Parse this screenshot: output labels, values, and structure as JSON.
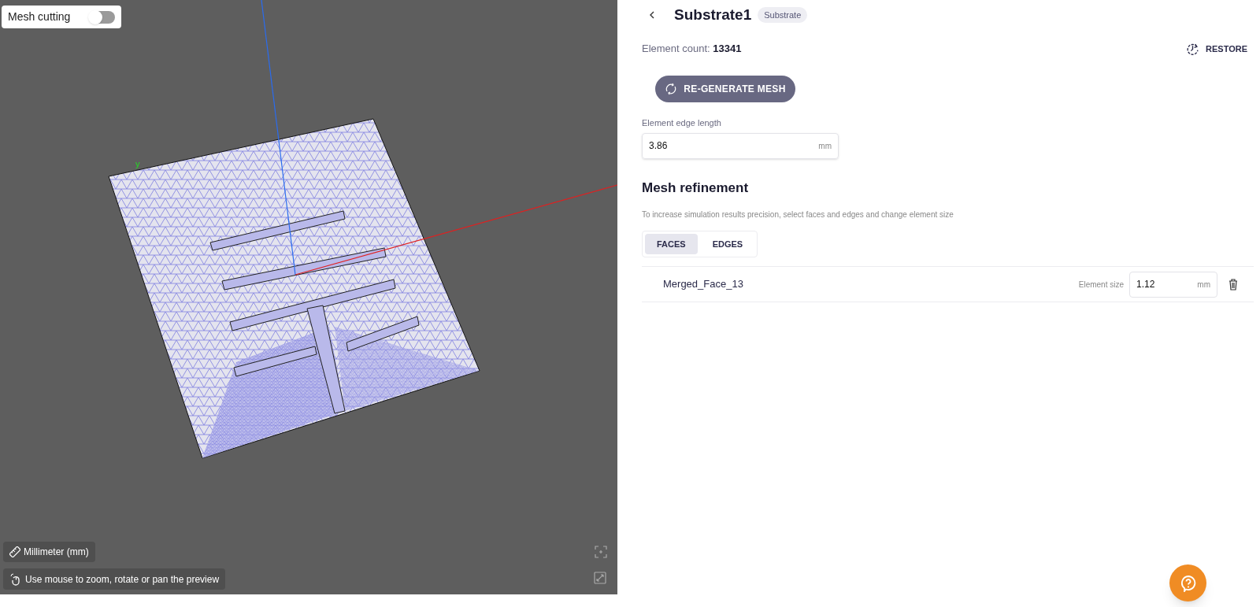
{
  "viewport": {
    "mesh_cutting": {
      "label": "Mesh cutting",
      "on": false
    },
    "axis_label": "y",
    "units": "Millimeter (mm)",
    "hint": "Use mouse to zoom, rotate or pan the preview"
  },
  "panel": {
    "title": "Substrate1",
    "badge": "Substrate",
    "count_label": "Element count:",
    "count_value": "13341",
    "restore": "RESTORE",
    "regenerate": "RE-GENERATE MESH",
    "edge_length": {
      "label": "Element edge length",
      "value": "3.86",
      "unit": "mm"
    },
    "refinement": {
      "title": "Mesh refinement",
      "description": "To increase simulation results precision, select faces and edges and change element size",
      "tabs": [
        {
          "label": "FACES",
          "selected": true
        },
        {
          "label": "EDGES",
          "selected": false
        }
      ],
      "items": [
        {
          "name": "Merged_Face_13",
          "size_label": "Element size",
          "value": "1.12",
          "unit": "mm"
        }
      ]
    }
  }
}
